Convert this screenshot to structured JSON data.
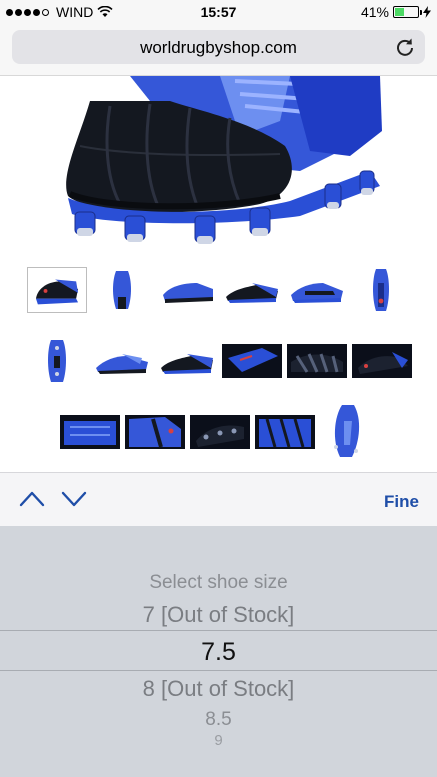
{
  "status": {
    "carrier": "WIND",
    "time": "15:57",
    "battery": "41%",
    "battery_level": 0.41
  },
  "browser": {
    "url": "worldrugbyshop.com"
  },
  "toolbar": {
    "done_label": "Fine"
  },
  "picker": {
    "title": "Select shoe size",
    "options": [
      "7 [Out of Stock]",
      "7.5",
      "8 [Out of Stock]",
      "8.5",
      "9"
    ],
    "selected": "7.5"
  },
  "colors": {
    "accent": "#1f4ea8",
    "boot_blue": "#2a4fd6",
    "boot_black": "#141820"
  }
}
